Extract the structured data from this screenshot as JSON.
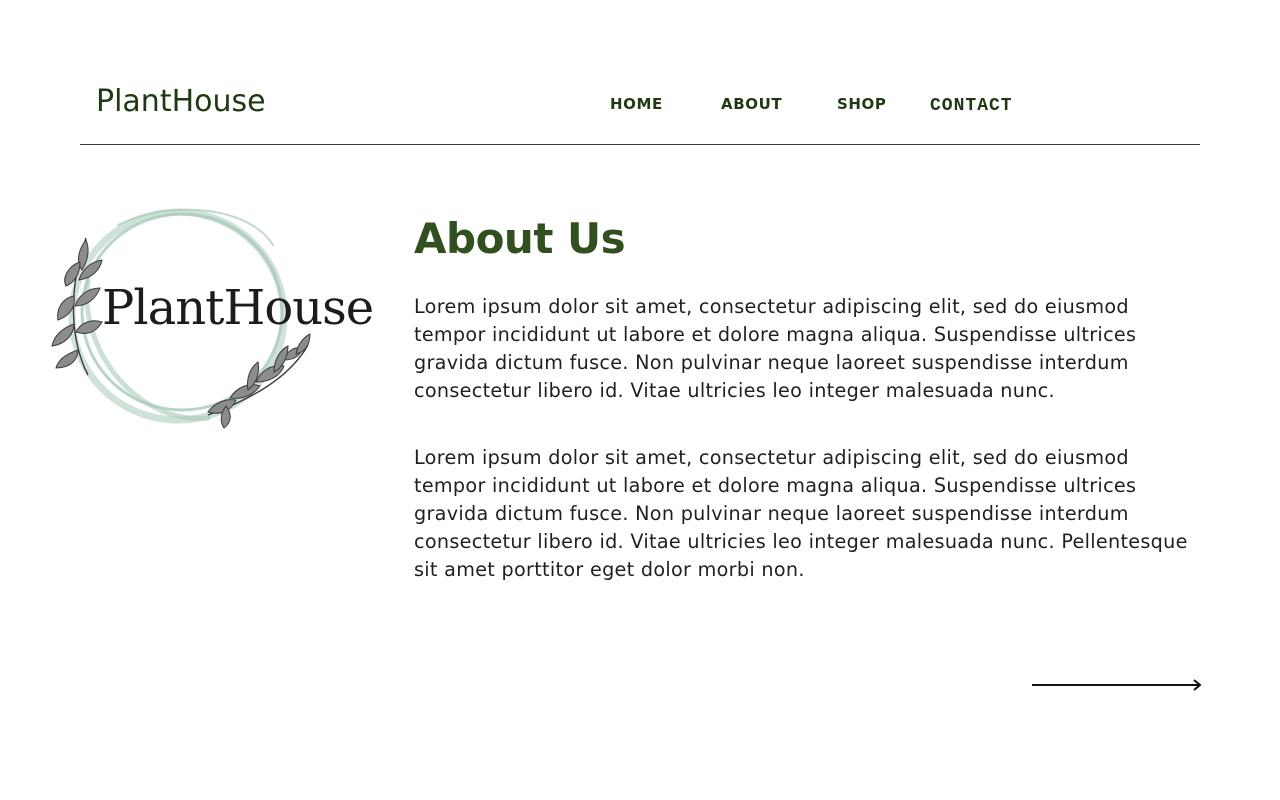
{
  "header": {
    "brand": "PlantHouse",
    "nav": [
      {
        "label": "HOME"
      },
      {
        "label": "ABOUT"
      },
      {
        "label": "SHOP"
      },
      {
        "label": "CONTACT"
      }
    ]
  },
  "logo": {
    "text": "PlantHouse",
    "ring_color": "#a8cbb8",
    "leaf_color": "#4a4a4a"
  },
  "main": {
    "title": "About Us",
    "paragraphs": [
      "Lorem ipsum dolor sit amet, consectetur adipiscing elit, sed do eiusmod tempor incididunt ut labore et dolore magna aliqua. Suspendisse ultrices gravida dictum fusce. Non pulvinar neque laoreet suspendisse interdum consectetur libero id. Vitae ultricies leo integer malesuada nunc.",
      "Lorem ipsum dolor sit amet, consectetur adipiscing elit, sed do eiusmod tempor incididunt ut labore et dolore magna aliqua. Suspendisse ultrices gravida dictum fusce. Non pulvinar neque laoreet suspendisse interdum consectetur libero id. Vitae ultricies leo integer malesuada nunc. Pellentesque sit amet porttitor eget dolor morbi non."
    ]
  },
  "footer": {
    "next_icon": "arrow-right-icon"
  },
  "colors": {
    "brand": "#1f3a12",
    "title": "#30501f",
    "divider": "#3a3a3a"
  }
}
